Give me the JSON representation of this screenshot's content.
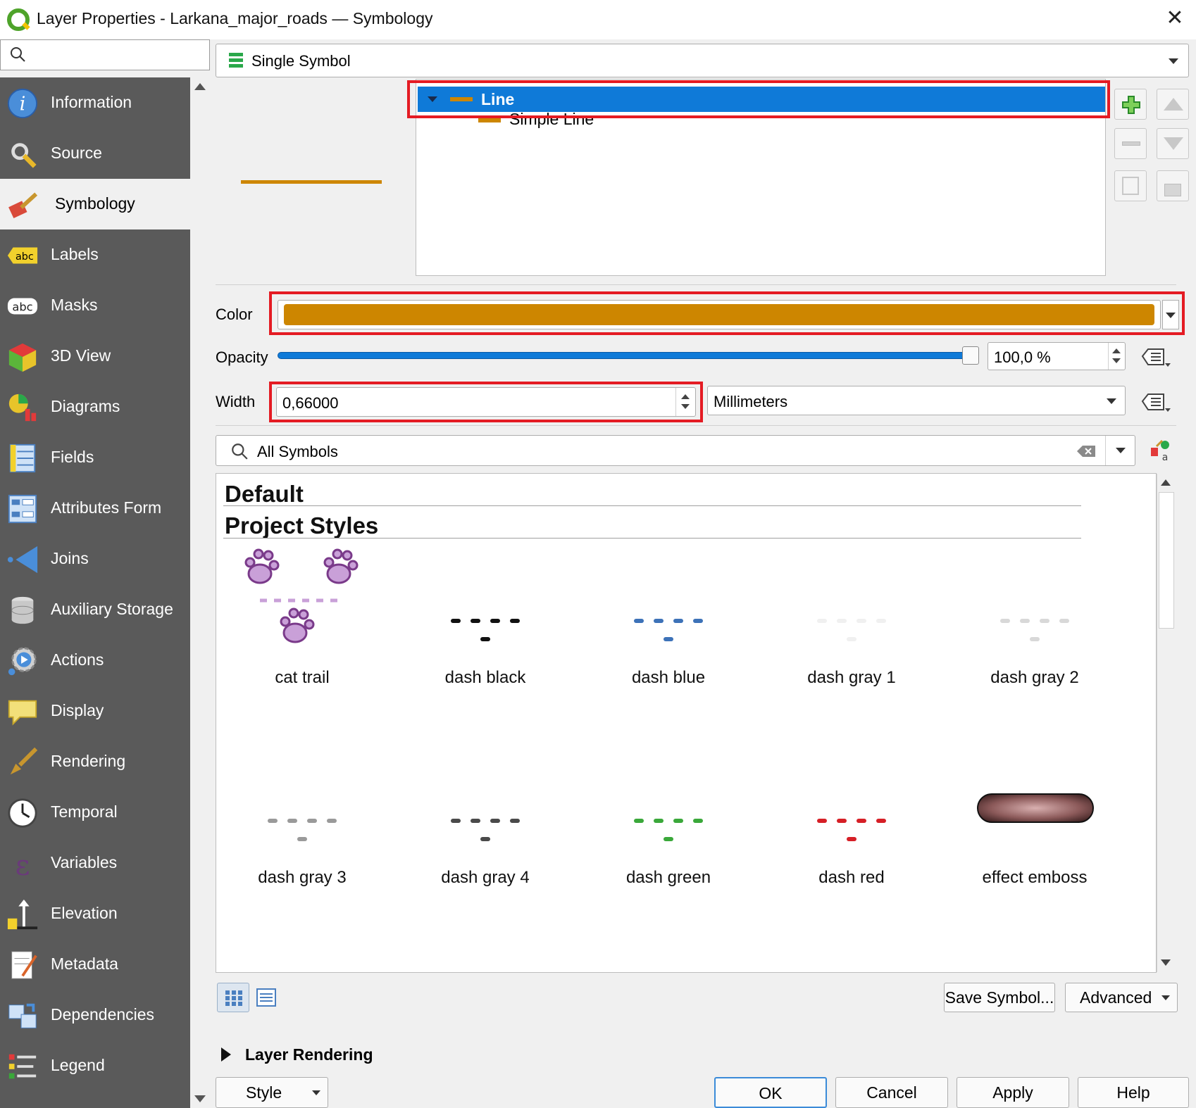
{
  "window": {
    "title": "Layer Properties - Larkana_major_roads — Symbology",
    "close_icon": "✕"
  },
  "sidebar": {
    "search_placeholder": "",
    "items": [
      {
        "label": "Information",
        "icon": "information-icon"
      },
      {
        "label": "Source",
        "icon": "source-icon"
      },
      {
        "label": "Symbology",
        "icon": "symbology-icon"
      },
      {
        "label": "Labels",
        "icon": "labels-icon"
      },
      {
        "label": "Masks",
        "icon": "masks-icon"
      },
      {
        "label": "3D View",
        "icon": "3d-view-icon"
      },
      {
        "label": "Diagrams",
        "icon": "diagrams-icon"
      },
      {
        "label": "Fields",
        "icon": "fields-icon"
      },
      {
        "label": "Attributes Form",
        "icon": "attributes-form-icon"
      },
      {
        "label": "Joins",
        "icon": "joins-icon"
      },
      {
        "label": "Auxiliary Storage",
        "icon": "auxiliary-storage-icon"
      },
      {
        "label": "Actions",
        "icon": "actions-icon"
      },
      {
        "label": "Display",
        "icon": "display-icon"
      },
      {
        "label": "Rendering",
        "icon": "rendering-icon"
      },
      {
        "label": "Temporal",
        "icon": "temporal-icon"
      },
      {
        "label": "Variables",
        "icon": "variables-icon"
      },
      {
        "label": "Elevation",
        "icon": "elevation-icon"
      },
      {
        "label": "Metadata",
        "icon": "metadata-icon"
      },
      {
        "label": "Dependencies",
        "icon": "dependencies-icon"
      },
      {
        "label": "Legend",
        "icon": "legend-icon"
      }
    ],
    "selected": "Symbology"
  },
  "renderer": {
    "selected": "Single Symbol"
  },
  "symbol_tree": {
    "root": "Line",
    "child": "Simple Line"
  },
  "colors": {
    "symbol": "#cd8600",
    "highlight": "#e41b23",
    "accent": "#0f7ad8"
  },
  "color_row": {
    "label": "Color"
  },
  "opacity_row": {
    "label": "Opacity",
    "value": "100,0 %",
    "level": 1.0
  },
  "width_row": {
    "label": "Width",
    "value": "0,66000",
    "unit": "Millimeters"
  },
  "library": {
    "filter": "All Symbols",
    "sections": [
      "Default",
      "Project Styles"
    ],
    "symbols": [
      {
        "name": "cat trail",
        "color": "#c9a0d8"
      },
      {
        "name": "dash  black",
        "color": "#111111"
      },
      {
        "name": "dash blue",
        "color": "#3d72b8"
      },
      {
        "name": "dash gray 1",
        "color": "#f0f0f0"
      },
      {
        "name": "dash gray 2",
        "color": "#d8d8d8"
      },
      {
        "name": "dash gray 3",
        "color": "#9a9a9a"
      },
      {
        "name": "dash gray 4",
        "color": "#4a4a4a"
      },
      {
        "name": "dash green",
        "color": "#3aa83a"
      },
      {
        "name": "dash red",
        "color": "#d61f26"
      },
      {
        "name": "effect emboss",
        "color": "#8c5a5a"
      }
    ]
  },
  "actions": {
    "save_symbol": "Save Symbol...",
    "advanced": "Advanced",
    "layer_rendering": "Layer Rendering",
    "style": "Style",
    "ok": "OK",
    "cancel": "Cancel",
    "apply": "Apply",
    "help": "Help"
  }
}
